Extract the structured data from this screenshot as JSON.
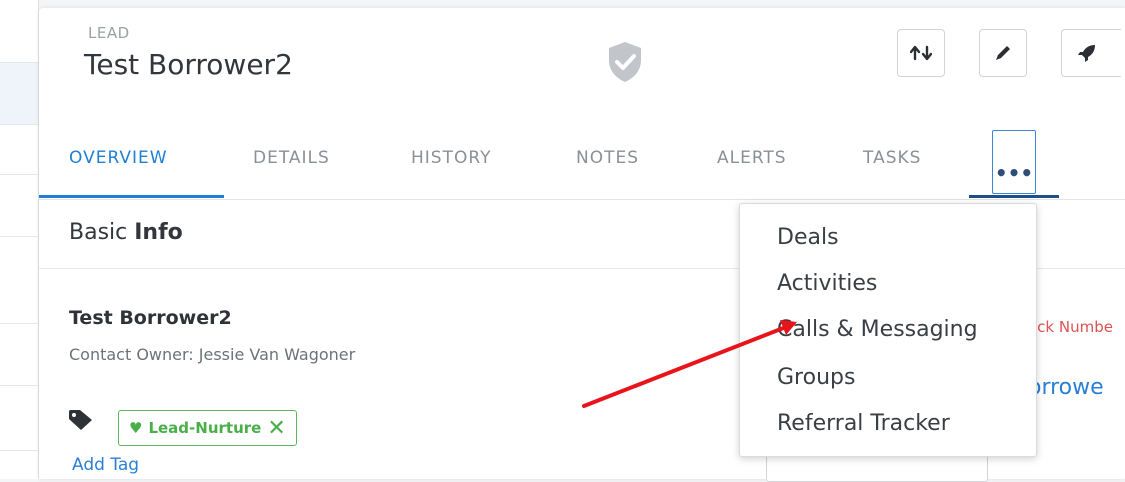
{
  "header": {
    "record_type": "LEAD",
    "record_name": "Test Borrower2"
  },
  "icons": {
    "shield": "shield-check-icon",
    "transfer": "transfer-arrows-icon",
    "edit": "pencil-icon",
    "launch": "rocket-icon",
    "tag": "tag-icon",
    "more": "ellipsis-icon",
    "heart": "heart-icon",
    "close": "close-icon"
  },
  "tabs": [
    {
      "label": "OVERVIEW",
      "active": true
    },
    {
      "label": "DETAILS",
      "active": false
    },
    {
      "label": "HISTORY",
      "active": false
    },
    {
      "label": "NOTES",
      "active": false
    },
    {
      "label": "ALERTS",
      "active": false
    },
    {
      "label": "TASKS",
      "active": false
    }
  ],
  "more_button": {
    "label": "•••"
  },
  "section": {
    "title_prefix": "Basic ",
    "title_bold": "Info"
  },
  "contact": {
    "name": "Test Borrower2",
    "owner": "Contact Owner: Jessie Van Wagoner"
  },
  "tag": {
    "label": "Lead-Nurture",
    "heart": "♥",
    "remove": "✕",
    "add_label": "Add Tag"
  },
  "right_partial": {
    "red_text": "ock Numbe",
    "blue_text": "orrowe"
  },
  "dropdown": {
    "items": [
      "Deals",
      "Activities",
      "Calls & Messaging",
      "Groups",
      "Referral Tracker"
    ]
  },
  "colors": {
    "accent": "#1f7fd4",
    "tag_green": "#4aae4a",
    "annotation_arrow": "#e8141b"
  }
}
